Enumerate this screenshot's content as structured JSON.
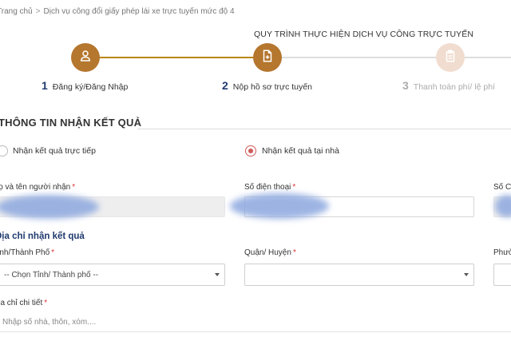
{
  "breadcrumb": {
    "home": "Trang chủ",
    "separator": ">",
    "current": "Dịch vụ công đổi giấy phép lái xe trực tuyến mức độ 4"
  },
  "process": {
    "title": "QUY TRÌNH THỰC HIỆN DỊCH VỤ CÔNG TRỰC TUYẾN",
    "steps": [
      {
        "num": "1",
        "label": "Đăng ký/Đăng Nhập",
        "icon": "user-icon",
        "state": "done"
      },
      {
        "num": "2",
        "label": "Nộp hồ sơ trực tuyến",
        "icon": "document-add-icon",
        "state": "current"
      },
      {
        "num": "3",
        "label": "Thanh toán phí/ lệ phí",
        "icon": "clipboard-icon",
        "state": "future"
      }
    ]
  },
  "section": {
    "title": "THÔNG TIN NHẬN KẾT QUẢ"
  },
  "delivery": {
    "options": [
      {
        "label": "Nhận kết quả trực tiếp",
        "checked": false
      },
      {
        "label": "Nhận kết quả tại nhà",
        "checked": true
      }
    ]
  },
  "recipient": {
    "name_label": "Họ và tên người nhận",
    "phone_label": "Số điện thoại",
    "third_label": "Số C",
    "required_mark": "*"
  },
  "address": {
    "title": "Địa chỉ nhận kết quả",
    "province_label": "Tỉnh/Thành Phố",
    "province_value": "-- Chọn Tỉnh/ Thành phố --",
    "district_label": "Quận/ Huyện",
    "district_value": "",
    "ward_label": "Phườ",
    "detail_label": "Địa chỉ chi tiết",
    "detail_placeholder": "Nhập số nhà, thôn, xóm...."
  },
  "colors": {
    "step_active": "#b5762e",
    "step_future": "#f1ddd0",
    "radio_checked": "#d05a5a",
    "heading_blue": "#1f3a6e"
  }
}
